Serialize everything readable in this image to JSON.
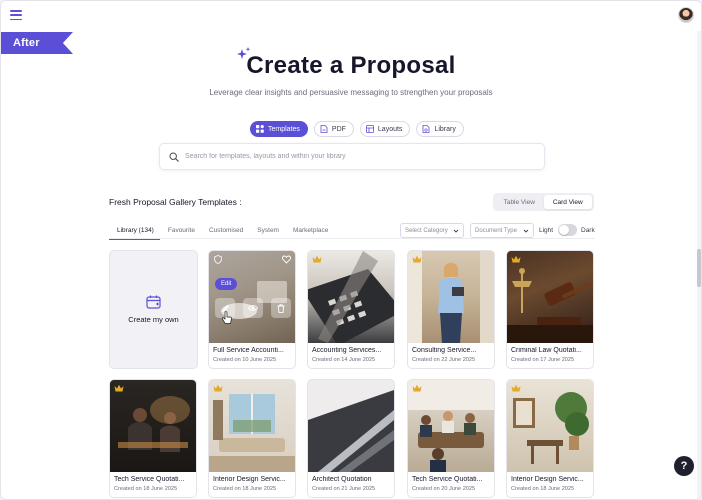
{
  "header": {
    "ribbon": "After"
  },
  "hero": {
    "title": "Create a Proposal",
    "subtitle": "Leverage clear insights and persuasive messaging to strengthen your proposals"
  },
  "mode_tabs": [
    {
      "label": "Templates",
      "icon": "templates-icon",
      "active": true
    },
    {
      "label": "PDF",
      "icon": "pdf-icon",
      "active": false
    },
    {
      "label": "Layouts",
      "icon": "layouts-icon",
      "active": false
    },
    {
      "label": "Library",
      "icon": "library-icon",
      "active": false
    }
  ],
  "search": {
    "placeholder": "Search for templates, layouts and within your library",
    "value": ""
  },
  "gallery": {
    "heading": "Fresh Proposal Gallery Templates :",
    "view_toggle": {
      "table": "Table View",
      "card": "Card View",
      "active": "Card View"
    },
    "filter_tabs": [
      "Library (134)",
      "Favourite",
      "Customised",
      "System",
      "Marketplace"
    ],
    "active_filter": "Library (134)",
    "category_dropdown": "Select Category",
    "document_dropdown": "Document Type",
    "theme": {
      "light": "Light",
      "dark": "Dark",
      "selected": "Light"
    },
    "create_label": "Create my own",
    "hover_card": {
      "edit_label": "Edit"
    }
  },
  "cards": [
    {
      "title": "Full Service Accounti...",
      "date": "Created on 10 June 2025",
      "icon": "shield-icon"
    },
    {
      "title": "Accounting Services...",
      "date": "Created on 14 June 2025",
      "icon": "crown-icon"
    },
    {
      "title": "Consulting  Service...",
      "date": "Created on 22 June 2025",
      "icon": "crown-icon"
    },
    {
      "title": "Criminal Law Quotati...",
      "date": "Created on 17 June 2025",
      "icon": "crown-icon"
    },
    {
      "title": "Tech Service Quotati...",
      "date": "Created on 18 June 2025",
      "icon": "crown-icon"
    },
    {
      "title": "Interior Design Servic...",
      "date": "Created on 18 June 2025",
      "icon": "crown-icon"
    },
    {
      "title": "Architect Quotation",
      "date": "Created on 21 June 2025",
      "icon": ""
    },
    {
      "title": "Tech Service Quotati...",
      "date": "Created on 20 June 2025",
      "icon": "crown-icon"
    },
    {
      "title": "Interior Design Servic...",
      "date": "Created on 18 June 2025",
      "icon": "crown-icon"
    }
  ],
  "help": {
    "label": "?"
  },
  "colors": {
    "accent": "#5b4fd8",
    "text": "#17172b",
    "muted": "#6d6b7a",
    "crown": "#e3a92a"
  }
}
